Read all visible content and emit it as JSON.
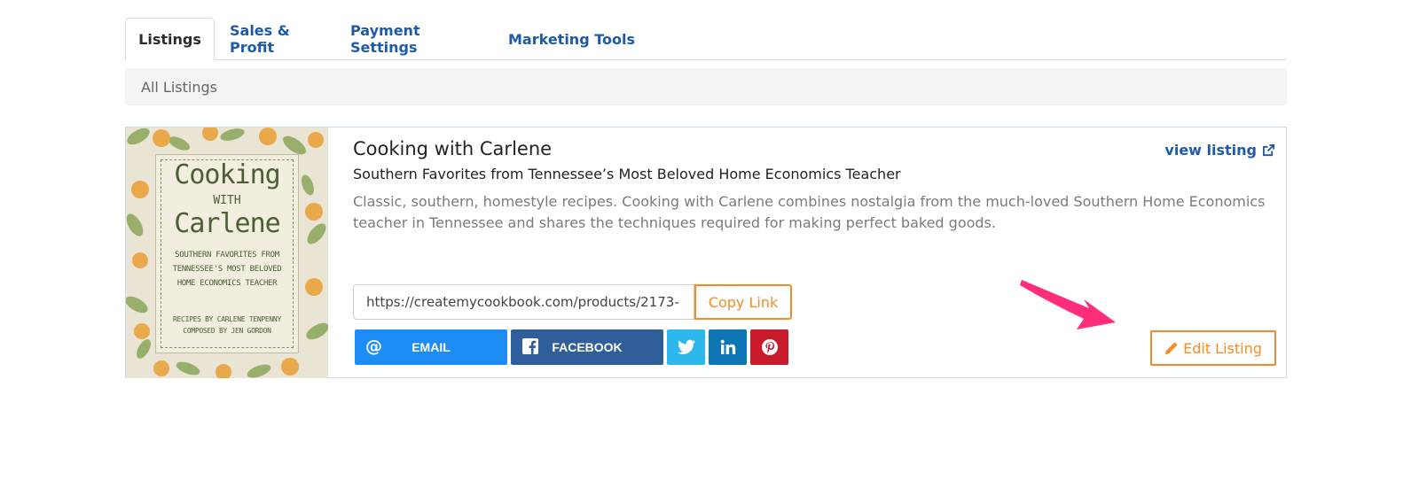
{
  "tabs": [
    {
      "label": "Listings",
      "active": true
    },
    {
      "label": "Sales & Profit",
      "active": false
    },
    {
      "label": "Payment Settings",
      "active": false
    },
    {
      "label": "Marketing Tools",
      "active": false
    }
  ],
  "breadcrumb": "All Listings",
  "listing": {
    "title": "Cooking with Carlene",
    "subtitle": "Southern Favorites from Tennessee’s Most Beloved Home Economics Teacher",
    "description": "Classic, southern, homestyle recipes. Cooking with Carlene combines nostalgia from the much-loved Southern Home Economics teacher in Tennessee and shares the techniques required for making perfect baked goods.",
    "view_link": "view listing",
    "link_value": "https://createmycookbook.com/products/2173-",
    "copy_label": "Copy Link",
    "edit_label": "Edit Listing",
    "cover": {
      "title_line1": "Cooking",
      "title_with": "WITH",
      "title_line2": "Carlene",
      "sub1": "SOUTHERN FAVORITES FROM",
      "sub2": "TENNESSEE'S MOST BELOVED",
      "sub3": "HOME ECONOMICS TEACHER",
      "credit1": "RECIPES BY CARLENE TENPENNY",
      "credit2": "COMPOSED BY JEN GORDON"
    }
  },
  "share": {
    "email": "EMAIL",
    "facebook": "FACEBOOK"
  },
  "icons": {
    "email": "at-icon",
    "facebook": "facebook-icon",
    "twitter": "twitter-icon",
    "linkedin": "linkedin-icon",
    "pinterest": "pinterest-icon",
    "external": "external-link-icon",
    "edit": "pencil-icon"
  },
  "colors": {
    "link_blue": "#1f5aa6",
    "accent_orange": "#f28c28",
    "annotation_arrow": "#ff2d7a"
  }
}
